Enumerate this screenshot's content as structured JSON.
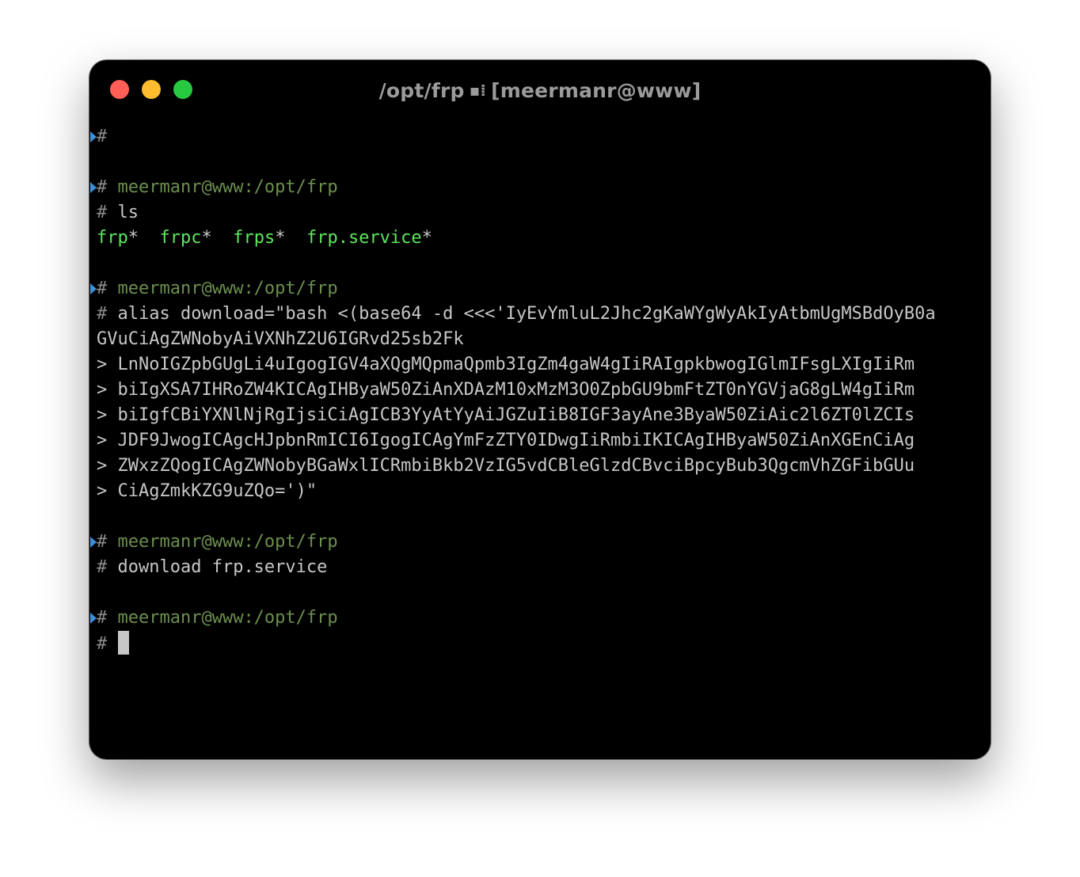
{
  "window": {
    "title_path": "/opt/frp",
    "title_separator_icon": "panes-divider-icon",
    "title_user": "[meermanr@www]",
    "traffic_lights": {
      "close_color": "#ff5f57",
      "minimize_color": "#febc2e",
      "zoom_color": "#28c840"
    }
  },
  "colors": {
    "background": "#000000",
    "prompt_marker": "#3b8fd9",
    "prompt_host": "#6c8f4e",
    "executable": "#5fe55f",
    "text": "#c7c7c7"
  },
  "terminal": {
    "hash": "#",
    "continuation": ">",
    "block0": {
      "marker_line": "#"
    },
    "block1": {
      "prompt": "meermanr@www:/opt/frp",
      "command": "ls",
      "files": [
        {
          "name": "frp",
          "suffix": "*"
        },
        {
          "name": "frpc",
          "suffix": "*"
        },
        {
          "name": "frps",
          "suffix": "*"
        },
        {
          "name": "frp.service",
          "suffix": "*"
        }
      ]
    },
    "block2": {
      "prompt": "meermanr@www:/opt/frp",
      "command": "alias download=\"bash <(base64 -d <<<'IyEvYmluL2Jhc2gKaWYgWyAkIyAtbmUgMSBdOyB0a",
      "wrap": "GVuCiAgZWNobyAiVXNhZ2U6IGRvd25sb2Fk",
      "continuations": [
        "LnNoIGZpbGUgLi4uIgogIGV4aXQgMQpmaQpmb3IgZm4gaW4gIiRAIgpkbwogIGlmIFsgLXIgIiRm",
        "biIgXSA7IHRoZW4KICAgIHByaW50ZiAnXDAzM10xMzM3O0ZpbGU9bmFtZT0nYGVjaG8gLW4gIiRm",
        "biIgfCBiYXNlNjRgIjsiCiAgICB3YyAtYyAiJGZuIiB8IGF3ayAne3ByaW50ZiAic2l6ZT0lZCIs",
        "JDF9JwogICAgcHJpbnRmICI6IgogICAgYmFzZTY0IDwgIiRmbiIKICAgIHByaW50ZiAnXGEnCiAg",
        "ZWxzZQogICAgZWNobyBGaWxlICRmbiBkb2VzIG5vdCBleGlzdCBvciBpcyBub3QgcmVhZGFibGUu",
        "CiAgZmkKZG9uZQo=')\""
      ]
    },
    "block3": {
      "prompt": "meermanr@www:/opt/frp",
      "command": "download frp.service"
    },
    "block4": {
      "prompt": "meermanr@www:/opt/frp"
    }
  }
}
